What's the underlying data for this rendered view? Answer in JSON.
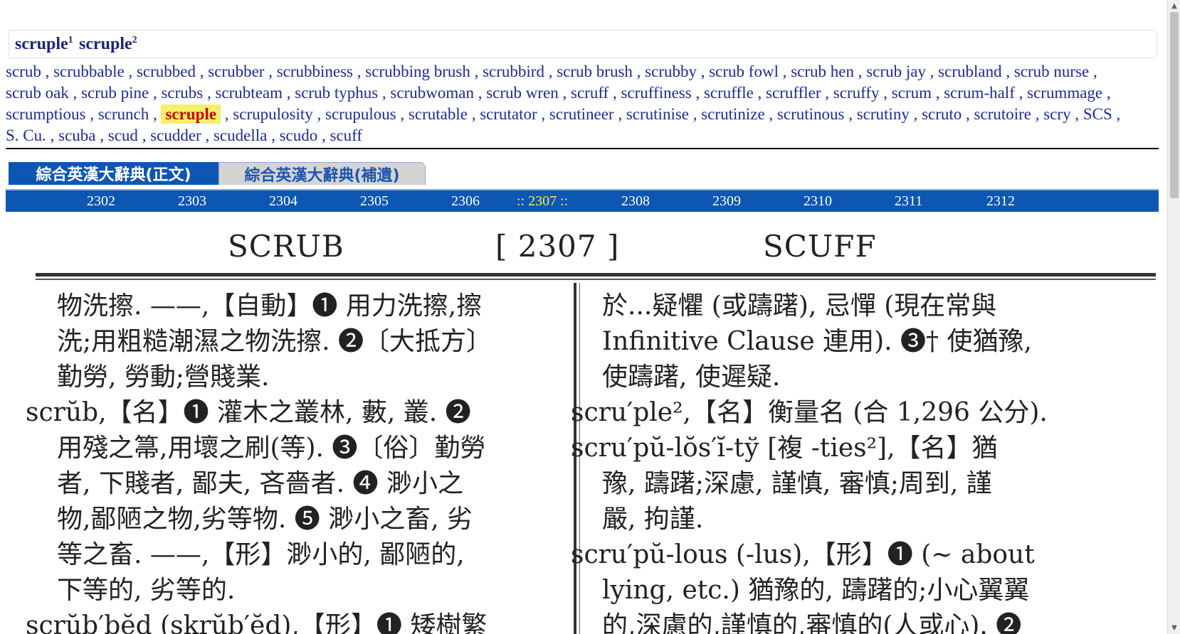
{
  "entries": [
    {
      "word": "scruple",
      "sup": "1"
    },
    {
      "word": "scruple",
      "sup": "2"
    }
  ],
  "related_words": [
    "scrub",
    "scrubbable",
    "scrubbed",
    "scrubber",
    "scrubbiness",
    "scrubbing brush",
    "scrubbird",
    "scrub brush",
    "scrubby",
    "scrub fowl",
    "scrub hen",
    "scrub jay",
    "scrubland",
    "scrub nurse",
    "scrub oak",
    "scrub pine",
    "scrubs",
    "scrubteam",
    "scrub typhus",
    "scrubwoman",
    "scrub wren",
    "scruff",
    "scruffiness",
    "scruffle",
    "scruffler",
    "scruffy",
    "scrum",
    "scrum-half",
    "scrummage",
    "scrumptious",
    "scrunch",
    "scruple",
    "scrupulosity",
    "scrupulous",
    "scrutable",
    "scrutator",
    "scrutineer",
    "scrutinise",
    "scrutinize",
    "scrutinous",
    "scrutiny",
    "scruto",
    "scrutoire",
    "scry",
    "SCS",
    "S. Cu.",
    "scuba",
    "scud",
    "scudder",
    "scudella",
    "scudo",
    "scuff"
  ],
  "current_word": "scruple",
  "tabs": {
    "main": "綜合英漢大辭典(正文)",
    "supplement": "綜合英漢大辭典(補遺)"
  },
  "pages": [
    "2302",
    "2303",
    "2304",
    "2305",
    "2306",
    ":: 2307 ::",
    "2308",
    "2309",
    "2310",
    "2311",
    "2312"
  ],
  "current_page": ":: 2307 ::",
  "scan": {
    "header_left": "SCRUB",
    "header_center": "[ 2307 ]",
    "header_right": "SCUFF",
    "left_lines": [
      "物洗擦.  ——,【自動】❶ 用力洗擦,擦",
      "洗;用粗糙潮濕之物洗擦. ❷〔大抵方〕",
      "勤勞, 勞動;營賤業.",
      "scrŭb,【名】❶ 灌木之叢林, 藪, 叢. ❷",
      "用殘之箒,用壞之刷(等). ❸〔俗〕勤勞",
      "者, 下賤者, 鄙夫, 吝嗇者. ❹ 渺小之",
      "物,鄙陋之物,劣等物. ❺ 渺小之畜, 劣",
      "等之畜. ——,【形】渺小的, 鄙陋的,",
      "下等的, 劣等的.",
      "scrŭb′bĕd (skrŭb′ĕd),【形】❶ 矮樹繁"
    ],
    "right_lines": [
      "於...疑懼 (或躊躇), 忌憚 (現在常與",
      "Infinitive Clause 連用). ❸† 使猶豫,",
      "使躊躇, 使遲疑.",
      "scru′ple²,【名】衡量名 (合 1,296 公分).",
      "scru′pŭ-lŏs′ĭ-tў [複 -ties²],【名】猶",
      "豫, 躊躇;深慮, 謹慎, 審慎;周到, 謹",
      "嚴, 拘謹.",
      "scru′pŭ-lous (-lus),【形】❶ (~ about",
      "lying, etc.) 猶豫的, 躊躇的;小心翼翼",
      "的,深慮的,謹慎的,審慎的(人或心). ❷"
    ]
  },
  "colors": {
    "link": "#1d2b9a",
    "highlight_bg": "#f5f06a",
    "highlight_text": "#c40000",
    "bar_blue": "#0d57b3",
    "current_page": "#ffe94a"
  }
}
